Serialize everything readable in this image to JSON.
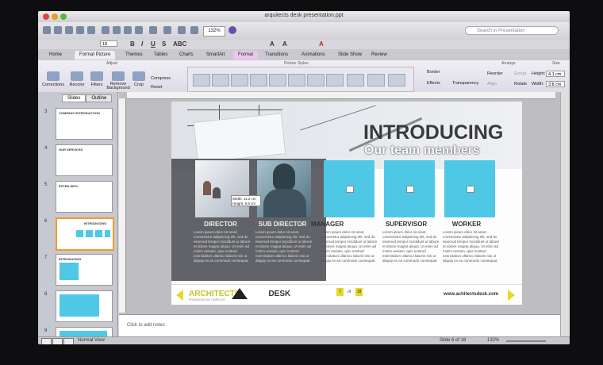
{
  "window": {
    "title": "arquitects desk presentation.ppt"
  },
  "toolbar": {
    "zoom": "132%",
    "search_placeholder": "Search in Presentation",
    "font_size": "18"
  },
  "ribbon_tabs": [
    {
      "label": "Home"
    },
    {
      "label": "Format Picture"
    },
    {
      "label": "Themes"
    },
    {
      "label": "Tables"
    },
    {
      "label": "Charts"
    },
    {
      "label": "SmartArt"
    },
    {
      "label": "Format"
    },
    {
      "label": "Transitions"
    },
    {
      "label": "Animations"
    },
    {
      "label": "Slide Show"
    },
    {
      "label": "Review"
    }
  ],
  "ribbon": {
    "adjust_label": "Adjust",
    "picture_styles_label": "Picture Styles",
    "arrange_label": "Arrange",
    "size_label": "Size",
    "corrections": "Corrections",
    "recolor": "Recolor",
    "filters": "Filters",
    "remove_background": "Remove Background",
    "crop": "Crop",
    "compress": "Compress",
    "reset": "Reset",
    "border": "Border",
    "effects": "Effects",
    "transparency": "Transparency",
    "reorder": "Reorder",
    "align": "Align",
    "group": "Group",
    "rotate": "Rotate",
    "height_label": "Height:",
    "height_value": "4.1 cm",
    "width_label": "Width:",
    "width_value": "3.8 cm"
  },
  "sidebar": {
    "tabs": [
      "Slides",
      "Outline"
    ],
    "slides": [
      {
        "num": "3",
        "title": "COMPANY INTRODUCTION"
      },
      {
        "num": "4",
        "title": "OUR SERVICES"
      },
      {
        "num": "5",
        "title": "EXTRA INFO"
      },
      {
        "num": "6",
        "title": "INTRODUCING"
      },
      {
        "num": "7",
        "title": "INTRODUCING"
      },
      {
        "num": "8",
        "title": ""
      },
      {
        "num": "9",
        "title": ""
      }
    ]
  },
  "slide": {
    "heading": "INTRODUCING",
    "subheading": "Our team members",
    "members": [
      {
        "role": "DIRECTOR"
      },
      {
        "role": "SUB DIRECTOR"
      },
      {
        "role": "MANAGER"
      },
      {
        "role": "SUPERVISOR"
      },
      {
        "role": "WORKER"
      }
    ],
    "lorem": "Lorem ipsum dolor sit amet, consectetur adipisicing elit, sed do eiusmod tempor incididunt ut labore et dolore magna aliqua. Ut enim ad minim veniam, quis nostrud exercitation ullamco laboris nisi ut aliquip ex ea commodo consequat.",
    "logo_text_a": "ARCHITECTS",
    "logo_text_b": "DESK",
    "logo_sub": "PRESENTATION TEMPLATE",
    "url": "www.achitectsdesk.com",
    "page_current": "7",
    "page_of": "of",
    "page_total": "18",
    "size_tooltip_w": "Width: 11.2 cm",
    "size_tooltip_h": "Height: 8.9 cm"
  },
  "notes": {
    "placeholder": "Click to add notes"
  },
  "status": {
    "view": "Normal View",
    "slide_info": "Slide 6 of 18",
    "zoom": "132%"
  },
  "colors": {
    "accent_cyan": "#4fc8e6",
    "highlight_yellow": "#e8d62a",
    "selected_thumb_border": "#f29a2e"
  }
}
